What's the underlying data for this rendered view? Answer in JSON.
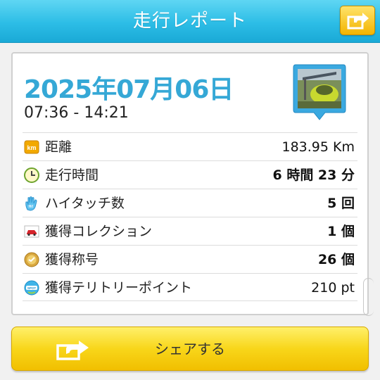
{
  "header": {
    "title": "走行レポート",
    "share_icon": "share-arrow-icon"
  },
  "report": {
    "date": "2025年07月06日",
    "time_range": "07:36 - 14:21",
    "thumbnail_icon": "spot-photo-pin-icon",
    "rows": [
      {
        "icon": "km-icon",
        "label": "距離",
        "value": "183.95 Km",
        "bold": false
      },
      {
        "icon": "clock-icon",
        "label": "走行時間",
        "value": "6 時間 23 分",
        "bold": true
      },
      {
        "icon": "hand-hightouch-icon",
        "label": "ハイタッチ数",
        "value": "5 回",
        "bold": true
      },
      {
        "icon": "car-collection-icon",
        "label": "獲得コレクション",
        "value": "1 個",
        "bold": true
      },
      {
        "icon": "title-medal-icon",
        "label": "獲得称号",
        "value": "26 個",
        "bold": true
      },
      {
        "icon": "spot-icon",
        "label": "獲得テリトリーポイント",
        "value": "210 pt",
        "bold": false
      }
    ]
  },
  "footer": {
    "share_label": "シェアする"
  },
  "colors": {
    "header": "#2cbde6",
    "date": "#35a8d6",
    "share_button": "#f8d61a"
  }
}
